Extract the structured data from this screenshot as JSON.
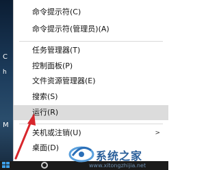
{
  "desktop": {
    "left_text_1": "C",
    "left_text_2": "h",
    "left_text_3": "M"
  },
  "context_menu": {
    "items": [
      {
        "label": "命令提示符(C)"
      },
      {
        "label": "命令提示符(管理员)(A)"
      },
      {
        "label": "任务管理器(T)"
      },
      {
        "label": "控制面板(P)"
      },
      {
        "label": "文件资源管理器(E)"
      },
      {
        "label": "搜索(S)"
      },
      {
        "label": "运行(R)",
        "highlighted": true
      },
      {
        "label": "关机或注销(U)",
        "has_submenu": true
      },
      {
        "label": "桌面(D)"
      }
    ],
    "submenu_arrow": ">"
  },
  "watermark": {
    "name": "系统之家",
    "url": "www.xitongzhijia.net"
  },
  "colors": {
    "highlight": "#dcdcdc",
    "arrow": "#d8262c",
    "watermark": "#2a5f9a",
    "start_blue": "#3d9ee8"
  },
  "icons": {
    "start": "windows-logo-icon",
    "search": "cortana-circle-icon",
    "annotation": "red-arrow-icon"
  }
}
